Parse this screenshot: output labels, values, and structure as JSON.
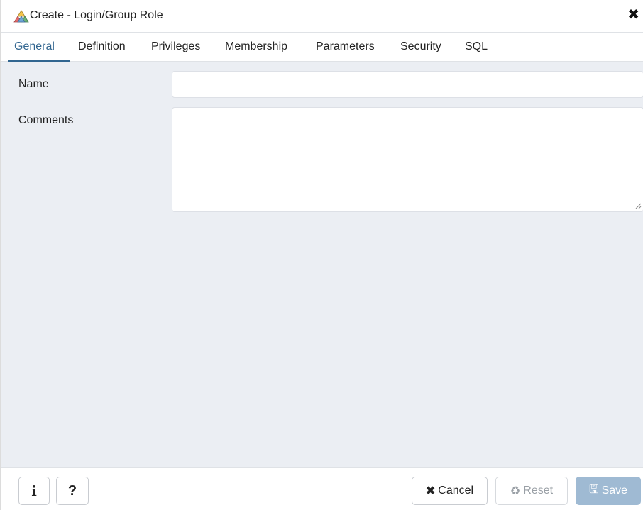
{
  "window": {
    "title": "Create - Login/Group Role",
    "close_glyph": "✖"
  },
  "tabs": [
    {
      "label": "General",
      "active": true
    },
    {
      "label": "Definition",
      "active": false
    },
    {
      "label": "Privileges",
      "active": false
    },
    {
      "label": "Membership",
      "active": false
    },
    {
      "label": "Parameters",
      "active": false
    },
    {
      "label": "Security",
      "active": false
    },
    {
      "label": "SQL",
      "active": false
    }
  ],
  "form": {
    "name_label": "Name",
    "name_value": "",
    "comments_label": "Comments",
    "comments_value": ""
  },
  "footer": {
    "info_glyph": "i",
    "help_glyph": "?",
    "cancel_icon": "✖",
    "cancel_label": "Cancel",
    "reset_icon": "♻",
    "reset_label": "Reset",
    "save_icon": "🖫",
    "save_label": "Save"
  },
  "colors": {
    "accent": "#326690",
    "content_bg": "#ebeef3",
    "save_disabled_bg": "#9fbad3"
  },
  "icons": {
    "title": "group-role-icon",
    "close": "close-icon",
    "info": "info-icon",
    "help": "help-icon",
    "cancel": "cancel-x-icon",
    "reset": "recycle-icon",
    "save": "floppy-disk-icon"
  }
}
